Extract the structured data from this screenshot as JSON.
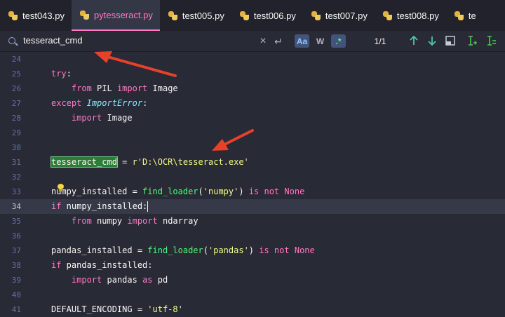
{
  "tabs": [
    {
      "label": "test043.py",
      "active": false
    },
    {
      "label": "pytesseract.py",
      "active": true
    },
    {
      "label": "test005.py",
      "active": false
    },
    {
      "label": "test006.py",
      "active": false
    },
    {
      "label": "test007.py",
      "active": false
    },
    {
      "label": "test008.py",
      "active": false
    },
    {
      "label": "te",
      "active": false
    }
  ],
  "search": {
    "query": "tesseract_cmd",
    "match_count": "1/1",
    "match_case_label": "Aa",
    "words_label": "W",
    "regex_label": ".*",
    "clear_label": "×",
    "newline_label": "↵"
  },
  "colors": {
    "background": "#282a36",
    "keyword": "#ff79c6",
    "function": "#50fa7b",
    "string": "#f1fa8c",
    "exception": "#8be9fd",
    "search_highlight": "#2d7d3a",
    "annotation_arrow": "#e8412b"
  },
  "editor": {
    "current_line": "34",
    "lines": [
      {
        "n": "24",
        "t": ""
      },
      {
        "n": "25",
        "t": "try:"
      },
      {
        "n": "26",
        "t": "    from PIL import Image"
      },
      {
        "n": "27",
        "t": "except ImportError:"
      },
      {
        "n": "28",
        "t": "    import Image"
      },
      {
        "n": "29",
        "t": ""
      },
      {
        "n": "30",
        "t": ""
      },
      {
        "n": "31",
        "t": "tesseract_cmd = r'D:\\OCR\\tesseract.exe'"
      },
      {
        "n": "32",
        "t": ""
      },
      {
        "n": "33",
        "t": "numpy_installed = find_loader('numpy') is not None"
      },
      {
        "n": "34",
        "t": "if numpy_installed:"
      },
      {
        "n": "35",
        "t": "    from numpy import ndarray"
      },
      {
        "n": "36",
        "t": ""
      },
      {
        "n": "37",
        "t": "pandas_installed = find_loader('pandas') is not None"
      },
      {
        "n": "38",
        "t": "if pandas_installed:"
      },
      {
        "n": "39",
        "t": "    import pandas as pd"
      },
      {
        "n": "40",
        "t": ""
      },
      {
        "n": "41",
        "t": "DEFAULT_ENCODING = 'utf-8'"
      }
    ]
  }
}
